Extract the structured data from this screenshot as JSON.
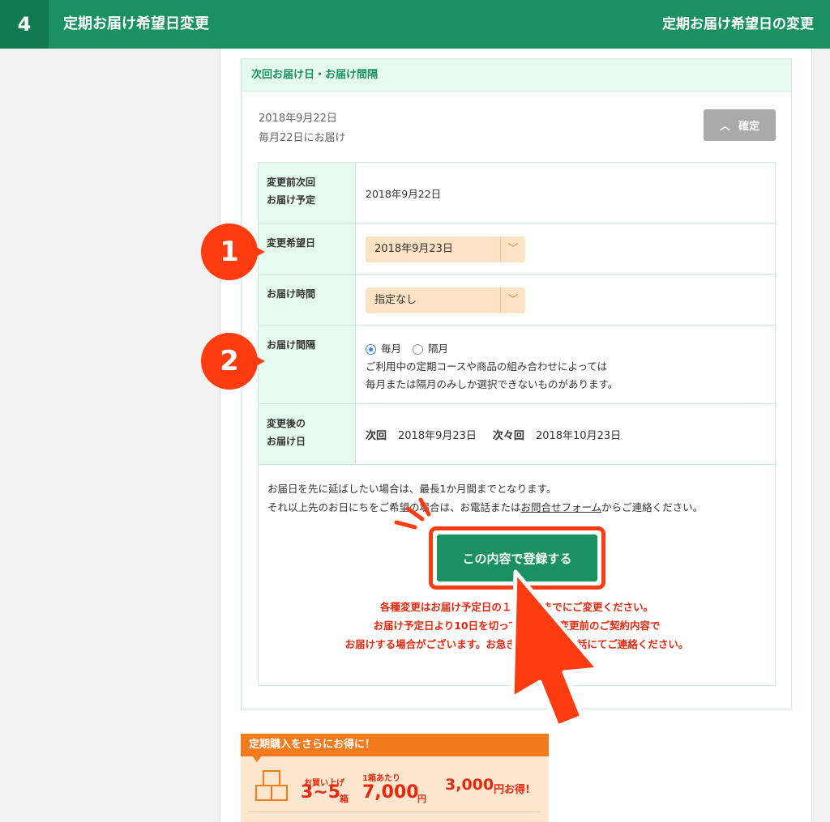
{
  "header": {
    "step": "4",
    "title": "定期お届け希望日変更",
    "right_title": "定期お届け希望日の変更"
  },
  "panel": {
    "heading": "次回お届け日・お届け間隔",
    "current_date": "2018年9月22日",
    "current_interval": "毎月22日にお届け",
    "confirm_label": "確定"
  },
  "form": {
    "rows": [
      {
        "label": "変更前次回\nお届け予定",
        "value": "2018年9月22日"
      },
      {
        "label": "変更希望日",
        "value": "2018年9月23日"
      },
      {
        "label": "お届け時間",
        "value": "指定なし"
      },
      {
        "label": "お届け間隔"
      },
      {
        "label": "変更後の\nお届け日"
      }
    ],
    "interval_options": [
      "毎月",
      "隔月"
    ],
    "interval_selected": "毎月",
    "interval_note_1": "ご利用中の定期コースや商品の組み合わせによっては",
    "interval_note_2": "毎月または隔月のみしか選択できないものがあります。",
    "after": {
      "next_label": "次回",
      "next_date": "2018年9月23日",
      "after_next_label": "次々回",
      "after_next_date": "2018年10月23日"
    }
  },
  "notes": {
    "line1": "お届日を先に延ばしたい場合は、最長1か月間までとなります。",
    "line2_pre": "それ以上先のお日にちをご希望の場合は、お電話または",
    "line2_link": "お問合せフォーム",
    "line2_post": "からご連絡ください。"
  },
  "register_label": "この内容で登録する",
  "warnings": [
    "各種変更はお届け予定日の１０日前までにご変更ください。",
    "お届け予定日より10日を切っての場合、変更前のご契約内容で",
    "お届けする場合がございます。お急ぎの場合はお電話にてご連絡ください。"
  ],
  "annotations": [
    "1",
    "2"
  ],
  "promo": {
    "title": "定期購入をさらにお得に！",
    "buy_label": "お買い上げ",
    "buy_range": "3~5",
    "buy_unit": "箱",
    "per_box_label": "1箱あたり",
    "per_box_price": "7,000",
    "per_box_unit": "円",
    "discount_value": "3,000",
    "discount_unit": "円お得!"
  },
  "colors": {
    "brand_green": "#1a9160",
    "accent_red": "#ff3b10",
    "select_bg": "#fde3c4",
    "promo_orange": "#f47b1c"
  }
}
